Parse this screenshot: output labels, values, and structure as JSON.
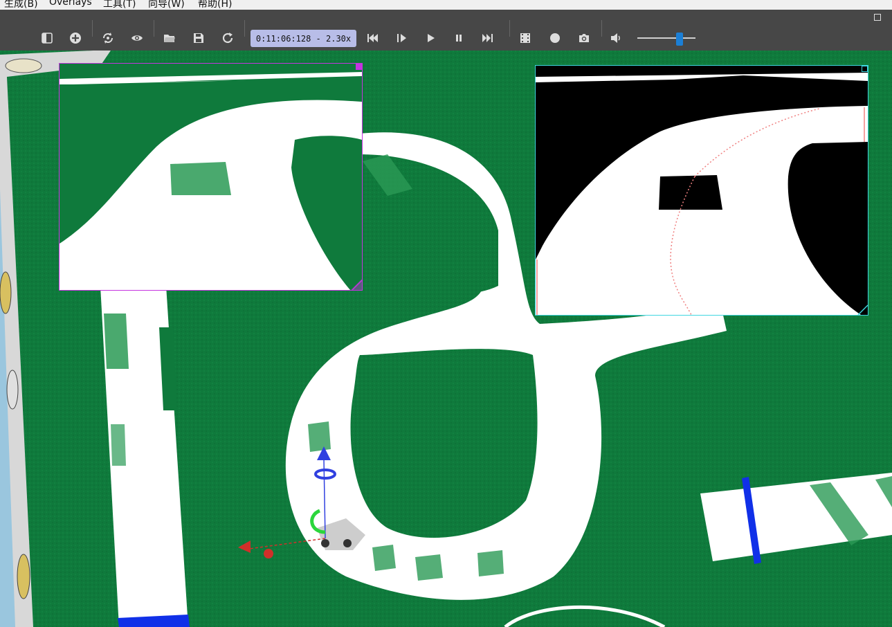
{
  "menu": {
    "items": [
      "生成(B)",
      "Overlays",
      "工具(T)",
      "向导(W)",
      "帮助(H)"
    ]
  },
  "toolbar": {
    "time": "0:11:06:128  - 2.30x",
    "volume_level": 0.76,
    "buttons": [
      {
        "name": "toggle-sidebar-icon"
      },
      {
        "name": "add-object-icon"
      },
      {
        "name": "sync-view-icon"
      },
      {
        "name": "visibility-eye-icon"
      },
      {
        "name": "open-folder-icon"
      },
      {
        "name": "save-disk-icon"
      },
      {
        "name": "reload-world-icon"
      },
      {
        "name": "step-backward-icon"
      },
      {
        "name": "step-icon"
      },
      {
        "name": "play-icon"
      },
      {
        "name": "pause-icon"
      },
      {
        "name": "fast-forward-icon"
      },
      {
        "name": "record-movie-icon"
      },
      {
        "name": "record-circle-icon"
      },
      {
        "name": "screenshot-camera-icon"
      },
      {
        "name": "volume-icon"
      }
    ]
  },
  "colors": {
    "toolbar_bg": "#474747",
    "grass": "#0f7a3c",
    "track": "#ffffff",
    "camera_overlay_border": "#c533e0",
    "binary_overlay_border": "#3fd6e0",
    "axis_x": "#d0302a",
    "axis_y": "#2bd63c",
    "axis_z": "#3040e0",
    "line_blue": "#1030e8"
  },
  "overlays": [
    {
      "name": "camera-overlay",
      "content": "robot camera view"
    },
    {
      "name": "binary-overlay",
      "content": "thresholded binary view with red center line"
    }
  ]
}
